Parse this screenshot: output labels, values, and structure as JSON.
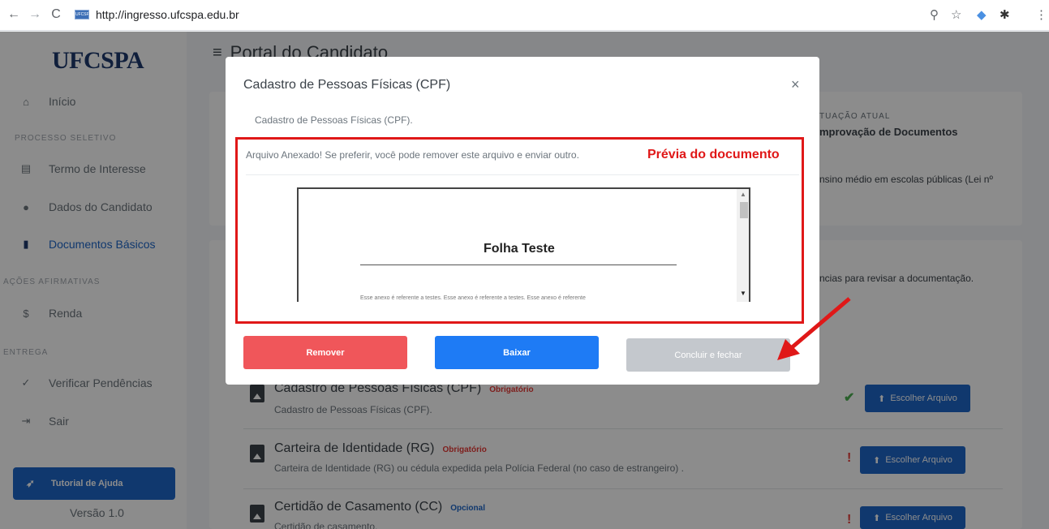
{
  "browser": {
    "url": "http://ingresso.ufcspa.edu.br",
    "favicon_text": "UFCSPA"
  },
  "sidebar": {
    "logo": "UFCSPA",
    "items": [
      {
        "label": "Início",
        "icon": "home-icon"
      },
      {
        "label": "Termo de Interesse",
        "icon": "print-icon"
      },
      {
        "label": "Dados do Candidato",
        "icon": "user-icon"
      },
      {
        "label": "Documentos Básicos",
        "icon": "file-icon"
      },
      {
        "label": "Renda",
        "icon": "dollar-icon"
      },
      {
        "label": "Verificar Pendências",
        "icon": "check-icon"
      },
      {
        "label": "Sair",
        "icon": "sign-out-icon"
      }
    ],
    "sections": [
      "PROCESSO SELETIVO",
      "AÇÕES AFIRMATIVAS",
      "ENTREGA"
    ],
    "help_button": "Tutorial de Ajuda",
    "version": "Versão 1.0"
  },
  "main": {
    "title": "Portal do Candidato",
    "situation_label": "TUAÇÃO ATUAL",
    "situation_value": "mprovação de Documentos",
    "quota_text": "nsino médio em escolas públicas (Lei nº",
    "review_text": "ncias para revisar a documentação.",
    "documents": [
      {
        "title": "Cadastro de Pessoas Físicas (CPF)",
        "badge": "Obrigatório",
        "desc": "Cadastro de Pessoas Físicas (CPF).",
        "button": "Escolher Arquivo",
        "status": "ok"
      },
      {
        "title": "Carteira de Identidade (RG)",
        "badge": "Obrigatório",
        "desc": "Carteira de Identidade (RG) ou cédula expedida pela Polícia Federal (no caso de estrangeiro) .",
        "button": "Escolher Arquivo",
        "status": "pending"
      },
      {
        "title": "Certidão de Casamento (CC)",
        "badge": "Opcional",
        "desc": "Certidão de casamento.",
        "button": "Escolher Arquivo",
        "status": "pending"
      }
    ]
  },
  "modal": {
    "title": "Cadastro de Pessoas Físicas (CPF)",
    "close": "×",
    "description": "Cadastro de Pessoas Físicas (CPF).",
    "attached_msg": "Arquivo Anexado! Se preferir, você pode remover este arquivo e enviar outro.",
    "preview_annotation": "Prévia do documento",
    "pdf": {
      "title": "Folha Teste",
      "body": "Esse anexo é referente a testes. Esse anexo é referente a testes. Esse anexo é referente"
    },
    "buttons": {
      "remove": "Remover",
      "download": "Baixar",
      "finish": "Concluir e fechar"
    }
  },
  "colors": {
    "primary": "#1e66c8",
    "danger": "#f0565a",
    "annotation": "#e01818",
    "ok": "#4caf50",
    "pending": "#e53935"
  }
}
